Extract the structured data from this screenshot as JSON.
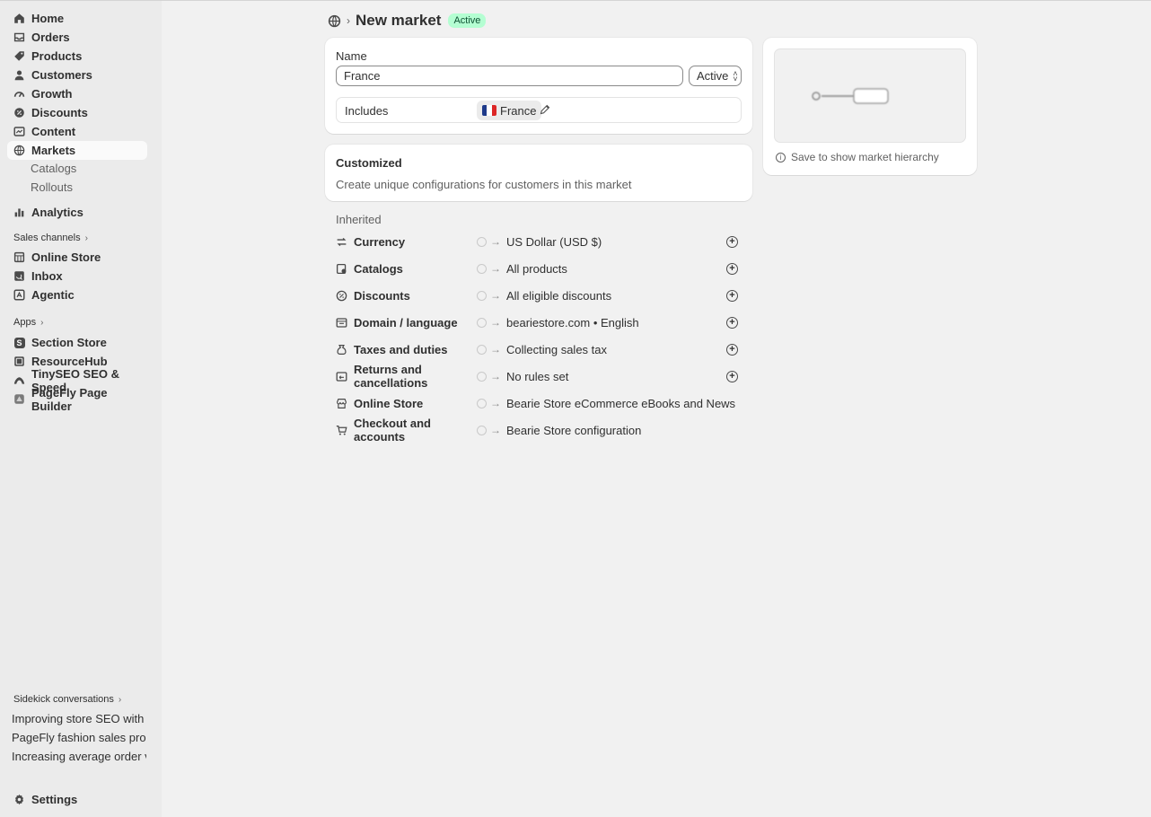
{
  "sidebar": {
    "items": [
      {
        "label": "Home",
        "icon": "home-icon"
      },
      {
        "label": "Orders",
        "icon": "inbox-icon"
      },
      {
        "label": "Products",
        "icon": "tag-icon"
      },
      {
        "label": "Customers",
        "icon": "person-icon"
      },
      {
        "label": "Growth",
        "icon": "gauge-icon"
      },
      {
        "label": "Discounts",
        "icon": "discount-icon"
      },
      {
        "label": "Content",
        "icon": "content-icon"
      },
      {
        "label": "Markets",
        "icon": "globe-icon"
      }
    ],
    "markets_sub": [
      "Catalogs",
      "Rollouts"
    ],
    "analytics": {
      "label": "Analytics",
      "icon": "chart-bar-icon"
    },
    "sales_channels_title": "Sales channels",
    "sales_channels": [
      {
        "label": "Online Store",
        "icon": "store-icon"
      },
      {
        "label": "Inbox",
        "icon": "chat-icon"
      },
      {
        "label": "Agentic",
        "icon": "agent-icon"
      }
    ],
    "apps_title": "Apps",
    "apps": [
      {
        "label": "Section Store",
        "icon": "section-store-icon",
        "glyph": "S"
      },
      {
        "label": "ResourceHub",
        "icon": "resourcehub-icon",
        "glyph": ""
      },
      {
        "label": "TinySEO SEO & Speed",
        "icon": "tinyseo-icon",
        "glyph": ""
      },
      {
        "label": "PageFly Page Builder",
        "icon": "pagefly-icon",
        "glyph": ""
      }
    ],
    "sidekick_title": "Sidekick conversations",
    "sidekick": [
      "Improving store SEO with Tin...",
      "PageFly fashion sales promot...",
      "Increasing average order val..."
    ],
    "settings": {
      "label": "Settings",
      "icon": "gear-icon"
    }
  },
  "header": {
    "title": "New market",
    "badge": "Active"
  },
  "name_card": {
    "name_label": "Name",
    "name_value": "France",
    "status_value": "Active",
    "includes_label": "Includes",
    "includes_pill": "France"
  },
  "customized_card": {
    "title": "Customized",
    "description": "Create unique configurations for customers in this market"
  },
  "inherited": {
    "title": "Inherited",
    "rows": [
      {
        "name": "Currency",
        "value": "US Dollar (USD $)",
        "icon": "currency-icon",
        "plus": true
      },
      {
        "name": "Catalogs",
        "value": "All products",
        "icon": "catalog-icon",
        "plus": true
      },
      {
        "name": "Discounts",
        "value": "All eligible discounts",
        "icon": "discount-icon",
        "plus": true
      },
      {
        "name": "Domain / language",
        "value": "beariestore.com • English",
        "icon": "domain-icon",
        "plus": true
      },
      {
        "name": "Taxes and duties",
        "value": "Collecting sales tax",
        "icon": "tax-icon",
        "plus": true
      },
      {
        "name": "Returns and cancellations",
        "value": "No rules set",
        "icon": "returns-icon",
        "plus": true
      },
      {
        "name": "Online Store",
        "value": "Bearie Store eCommerce eBooks and News",
        "icon": "store-icon",
        "plus": false
      },
      {
        "name": "Checkout and accounts",
        "value": "Bearie Store configuration",
        "icon": "cart-icon",
        "plus": false
      }
    ]
  },
  "hierarchy": {
    "hint": "Save to show market hierarchy"
  },
  "colors": {
    "accent_active_bg": "#b4fed2",
    "accent_active_text": "#0c5132",
    "sidebar_bg": "#ebebeb",
    "page_bg": "#f1f1f1",
    "flag_blue": "#1e3a8a",
    "flag_white": "#ffffff",
    "flag_red": "#dc2626"
  }
}
